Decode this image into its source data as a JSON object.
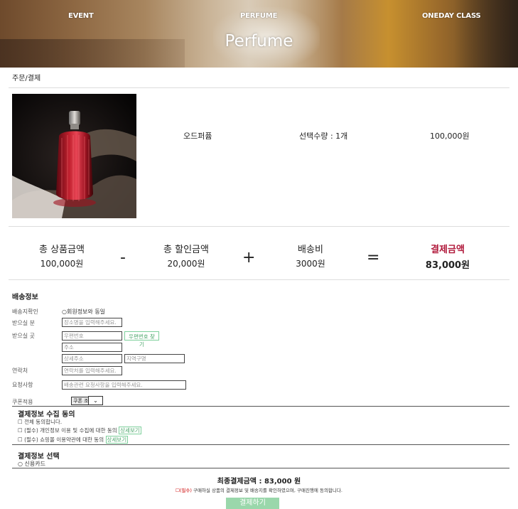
{
  "nav": {
    "event": "EVENT",
    "perfume": "PERFUME",
    "oneday": "ONEDAY CLASS"
  },
  "banner_title": "Perfume",
  "page_title": "주문/결제",
  "product": {
    "name": "오드퍼퓸",
    "quantity": "선택수량 : 1개",
    "price": "100,000원"
  },
  "summary": {
    "product_total_label": "총 상품금액",
    "product_total_value": "100,000원",
    "minus": "-",
    "discount_label": "총 할인금액",
    "discount_value": "20,000원",
    "plus": "+",
    "shipping_label": "배송비",
    "shipping_value": "3000원",
    "equals": "=",
    "payment_label": "결제금액",
    "payment_value": "83,000원"
  },
  "shipping": {
    "title": "배송정보",
    "confirm_label": "배송지확인",
    "confirm_option": "○회원정보와 동일",
    "recipient_label": "받으실 분",
    "recipient_placeholder": "장소명을 입력해주세요.",
    "address_label": "받으실 곳",
    "postcode_placeholder": "우편번호",
    "postcode_button": "우편번호 찾기",
    "address_placeholder": "주소",
    "detail_placeholder": "상세주소",
    "reference_placeholder": "지역구명",
    "phone_label": "연락처",
    "phone_placeholder": "연락처를 입력해주세요.",
    "request_label": "요청사항",
    "request_placeholder": "배송관련 요청사항을 입력해주세요.",
    "coupon_label": "쿠폰적용",
    "coupon_value": "쿠폰 조회",
    "coupon_select": "⌄"
  },
  "agreement": {
    "title": "결제정보 수집 동의",
    "all": "☐ 전체 동의합니다.",
    "privacy": "☐ (필수) 개인정보 이용 및 수집에 대한 동의",
    "terms": "☐ (필수) 쇼핑몰 이용약관에 대한 동의",
    "detail_link": "상세보기"
  },
  "payment_method": {
    "title": "결제정보 선택",
    "option": "○ 신용카드"
  },
  "final": {
    "total": "최종결제금액 : 83,000 원",
    "confirm_required": "☐(필수)",
    "confirm_text": " 구매하실 상품의 결제정보 및 배송지를 확인하였으며, 구매진행에 동의합니다.",
    "pay_button": "결제하기"
  },
  "colors": {
    "accent_green": "#9ad7ab",
    "payment_red": "#b0183a"
  }
}
